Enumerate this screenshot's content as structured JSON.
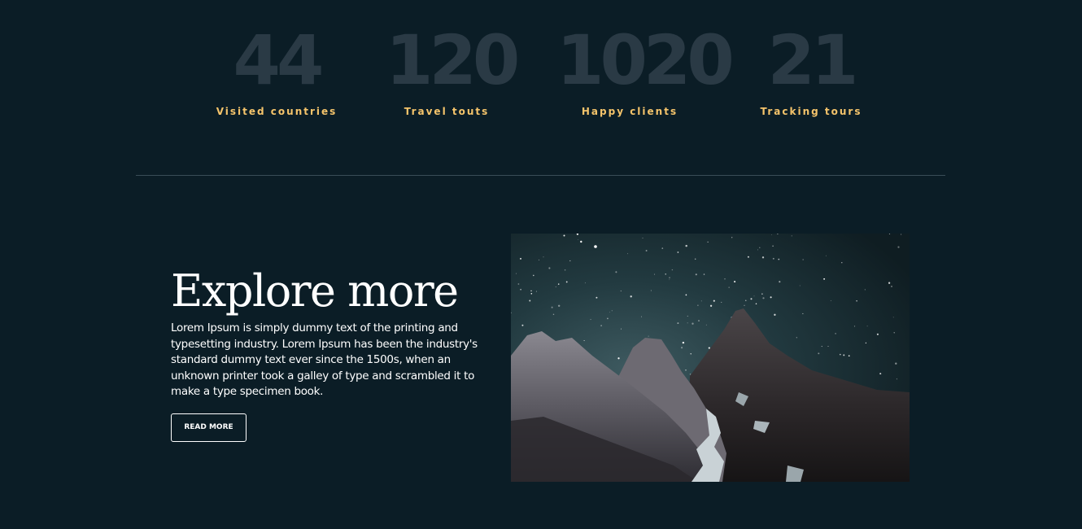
{
  "stats": [
    {
      "value": "44",
      "label": "Visited countries"
    },
    {
      "value": "120",
      "label": "Travel touts"
    },
    {
      "value": "1020",
      "label": "Happy clients"
    },
    {
      "value": "21",
      "label": "Tracking tours"
    }
  ],
  "explore": {
    "title": "Explore more",
    "body": "Lorem Ipsum is simply dummy text of the printing and typesetting industry. Lorem Ipsum has been the industry's standard dummy text ever since the 1500s, when an unknown printer took a galley of type and scrambled it to make a type specimen book.",
    "button_label": "READ MORE"
  },
  "colors": {
    "background": "#0b1d26",
    "stat_number": "#2a3a45",
    "stat_label": "#f5c46b",
    "text": "#ffffff"
  }
}
